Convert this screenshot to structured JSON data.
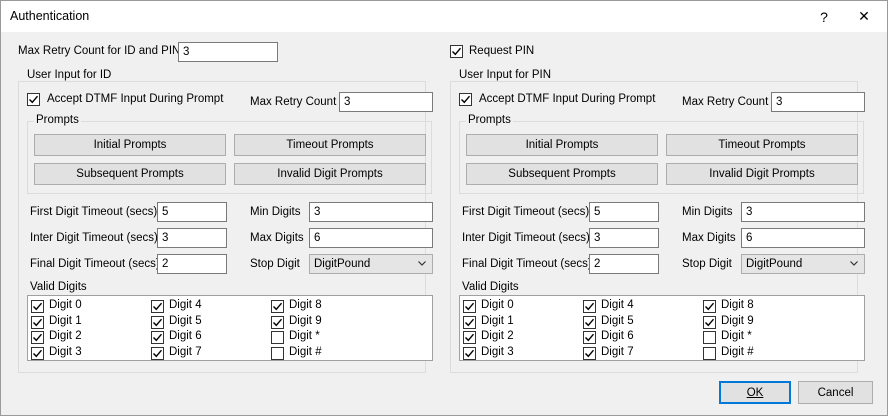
{
  "window": {
    "title": "Authentication",
    "help_glyph": "?",
    "close_glyph": "✕"
  },
  "top": {
    "max_retry_label": "Max Retry Count for ID and PIN",
    "max_retry_value": "3",
    "request_pin_label": "Request PIN",
    "request_pin_checked": true
  },
  "id_panel": {
    "group_title": "User Input for ID",
    "accept_dtmf_label": "Accept DTMF Input During Prompt",
    "accept_dtmf_checked": true,
    "max_retry_label": "Max Retry Count",
    "max_retry_value": "3",
    "prompts_title": "Prompts",
    "initial_prompts": "Initial Prompts",
    "timeout_prompts": "Timeout Prompts",
    "subsequent_prompts": "Subsequent Prompts",
    "invalid_digit_prompts": "Invalid Digit Prompts",
    "first_digit_label": "First Digit Timeout (secs)",
    "first_digit_value": "5",
    "inter_digit_label": "Inter Digit Timeout (secs)",
    "inter_digit_value": "3",
    "final_digit_label": "Final Digit Timeout (secs)",
    "final_digit_value": "2",
    "min_digits_label": "Min Digits",
    "min_digits_value": "3",
    "max_digits_label": "Max Digits",
    "max_digits_value": "6",
    "stop_digit_label": "Stop Digit",
    "stop_digit_value": "DigitPound",
    "valid_digits_label": "Valid Digits",
    "digits": [
      {
        "label": "Digit 0",
        "checked": true
      },
      {
        "label": "Digit 1",
        "checked": true
      },
      {
        "label": "Digit 2",
        "checked": true
      },
      {
        "label": "Digit 3",
        "checked": true
      },
      {
        "label": "Digit 4",
        "checked": true
      },
      {
        "label": "Digit 5",
        "checked": true
      },
      {
        "label": "Digit 6",
        "checked": true
      },
      {
        "label": "Digit 7",
        "checked": true
      },
      {
        "label": "Digit 8",
        "checked": true
      },
      {
        "label": "Digit 9",
        "checked": true
      },
      {
        "label": "Digit *",
        "checked": false
      },
      {
        "label": "Digit #",
        "checked": false
      }
    ]
  },
  "pin_panel": {
    "group_title": "User Input for PIN",
    "accept_dtmf_label": "Accept DTMF Input During Prompt",
    "accept_dtmf_checked": true,
    "max_retry_label": "Max Retry Count",
    "max_retry_value": "3",
    "prompts_title": "Prompts",
    "initial_prompts": "Initial Prompts",
    "timeout_prompts": "Timeout Prompts",
    "subsequent_prompts": "Subsequent Prompts",
    "invalid_digit_prompts": "Invalid Digit Prompts",
    "first_digit_label": "First Digit Timeout (secs)",
    "first_digit_value": "5",
    "inter_digit_label": "Inter Digit Timeout (secs)",
    "inter_digit_value": "3",
    "final_digit_label": "Final Digit Timeout (secs)",
    "final_digit_value": "2",
    "min_digits_label": "Min Digits",
    "min_digits_value": "3",
    "max_digits_label": "Max Digits",
    "max_digits_value": "6",
    "stop_digit_label": "Stop Digit",
    "stop_digit_value": "DigitPound",
    "valid_digits_label": "Valid Digits",
    "digits": [
      {
        "label": "Digit 0",
        "checked": true
      },
      {
        "label": "Digit 1",
        "checked": true
      },
      {
        "label": "Digit 2",
        "checked": true
      },
      {
        "label": "Digit 3",
        "checked": true
      },
      {
        "label": "Digit 4",
        "checked": true
      },
      {
        "label": "Digit 5",
        "checked": true
      },
      {
        "label": "Digit 6",
        "checked": true
      },
      {
        "label": "Digit 7",
        "checked": true
      },
      {
        "label": "Digit 8",
        "checked": true
      },
      {
        "label": "Digit 9",
        "checked": true
      },
      {
        "label": "Digit *",
        "checked": false
      },
      {
        "label": "Digit #",
        "checked": false
      }
    ]
  },
  "footer": {
    "ok_label": "OK",
    "cancel_label": "Cancel"
  },
  "colors": {
    "accent": "#0078d7",
    "dialog_bg": "#f0f0f0",
    "button_bg": "#e1e1e1"
  }
}
